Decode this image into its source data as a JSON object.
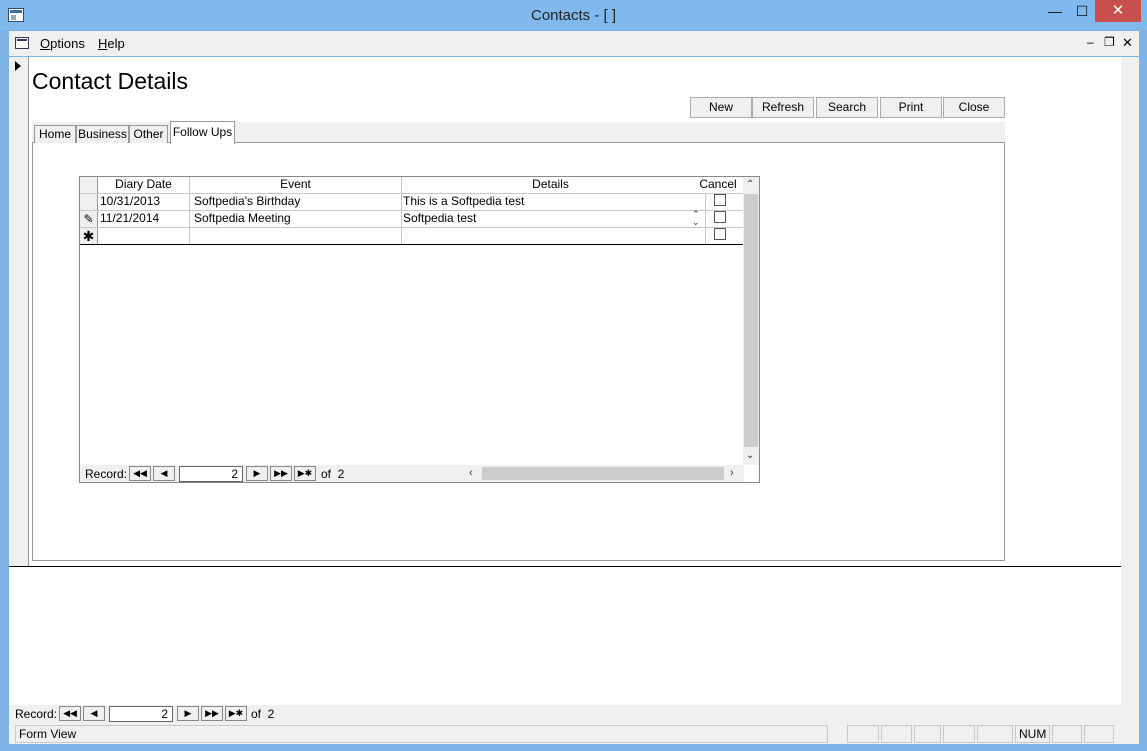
{
  "window": {
    "title": "Contacts - [ ]"
  },
  "menu": {
    "items": [
      {
        "label": "Options"
      },
      {
        "label": "Help"
      }
    ]
  },
  "form": {
    "title": "Contact Details"
  },
  "toolbar": {
    "new_label": "New",
    "refresh_label": "Refresh",
    "search_label": "Search",
    "print_label": "Print",
    "close_label": "Close"
  },
  "tabs": [
    {
      "label": "Home"
    },
    {
      "label": "Business"
    },
    {
      "label": "Other"
    },
    {
      "label": "Follow Ups",
      "active": true
    }
  ],
  "grid": {
    "columns": [
      "Diary Date",
      "Event",
      "Details",
      "Cancel"
    ],
    "rows": [
      {
        "date": "10/31/2013",
        "event": "Softpedia's Birthday",
        "details": "This is a Softpedia test",
        "cancel": false
      },
      {
        "date": "11/21/2014",
        "event": "Softpedia Meeting",
        "details": "Softpedia test",
        "cancel": false
      }
    ],
    "nav": {
      "label": "Record:",
      "current": "2",
      "of_text": "of  2"
    }
  },
  "record_nav": {
    "label": "Record:",
    "current": "2",
    "of_text": "of  2"
  },
  "status": {
    "mode": "Form View",
    "num": "NUM"
  },
  "colors": {
    "titlebar": "#80b9ee",
    "close_button": "#c7504d",
    "chrome": "#f0f0f0"
  },
  "icons": {
    "edit_row": "pencil-icon",
    "new_row": "asterisk-icon",
    "current_record": "triangle-right-icon"
  }
}
